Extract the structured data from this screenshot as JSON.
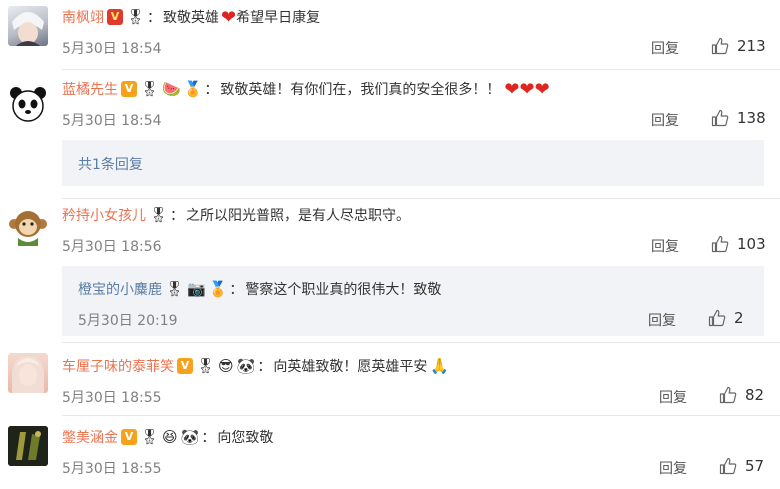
{
  "comments": [
    {
      "username": "南枫翊",
      "text": "致敬英雄",
      "text2": "希望早日康复",
      "time": "5月30日 18:54",
      "reply": "回复",
      "likes": "213"
    },
    {
      "username": "蓝橘先生",
      "text": "致敬英雄！有你们在，我们真的安全很多！！",
      "time": "5月30日 18:54",
      "reply": "回复",
      "likes": "138",
      "sub_replies": "共1条回复"
    },
    {
      "username": "矜持小女孩儿",
      "text": "之所以阳光普照，是有人尽忠职守。",
      "time": "5月30日 18:56",
      "reply": "回复",
      "likes": "103",
      "nested": {
        "username": "橙宝的小麋鹿",
        "text": "警察这个职业真的很伟大！致敬",
        "time": "5月30日 20:19",
        "reply": "回复",
        "likes": "2"
      }
    },
    {
      "username": "车厘子味的泰菲笑",
      "text": "向英雄致敬！愿英雄平安",
      "time": "5月30日 18:55",
      "reply": "回复",
      "likes": "82"
    },
    {
      "username": "鐅美涵金",
      "text": "向您致敬",
      "time": "5月30日 18:55",
      "reply": "回复",
      "likes": "57"
    }
  ],
  "colors": {
    "username": "#eb7350",
    "timestamp": "#808080",
    "reply_link": "#5a7ea6",
    "subbox_bg": "#f2f3f6",
    "heart": "#e0241f",
    "v_badge": "#f7a21c"
  },
  "icons": [
    "v-badge",
    "vip-badge",
    "watermelon-emoji",
    "medal-badge",
    "heart-emoji",
    "camera-badge",
    "sunglasses-emoji",
    "panda-emoji",
    "pray-emoji",
    "grin-emoji",
    "thumbs-up-icon"
  ]
}
